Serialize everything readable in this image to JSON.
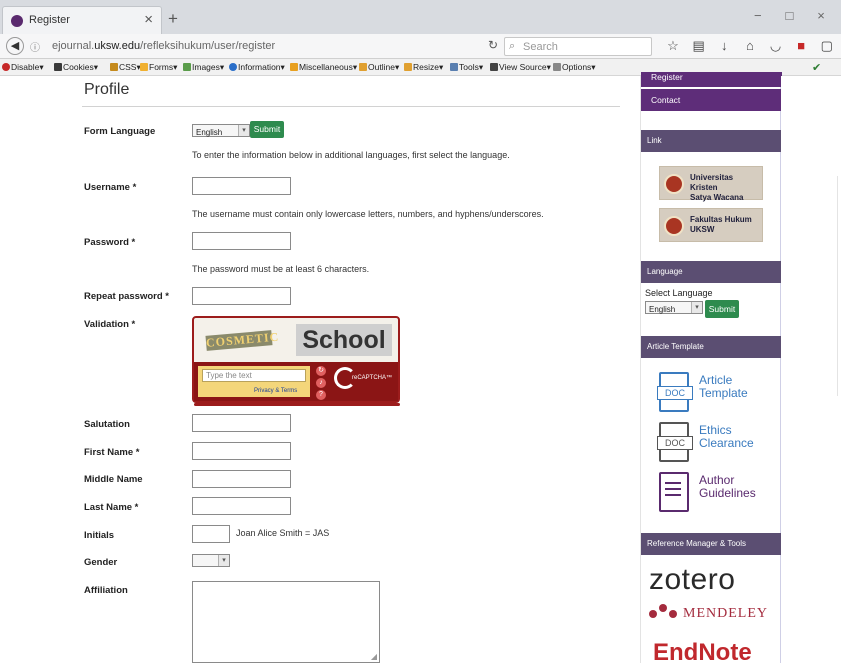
{
  "browser": {
    "tab_title": "Register",
    "tab_close": "×",
    "new_tab": "+",
    "window_controls": [
      "−",
      "□",
      "×"
    ],
    "url_prefix": "ejournal.",
    "url_domain": "uksw.edu",
    "url_path": "/refleksihukum/user/register",
    "search_placeholder": "Search",
    "nav_icons": [
      "star-icon",
      "reader-icon",
      "download-icon",
      "home-icon",
      "pocket-icon",
      "extension-icon",
      "sidebar-icon",
      "menu-icon"
    ]
  },
  "webdev_toolbar": {
    "items": [
      "Disable",
      "Cookies",
      "CSS",
      "Forms",
      "Images",
      "Information",
      "Miscellaneous",
      "Outline",
      "Resize",
      "Tools",
      "View Source",
      "Options"
    ]
  },
  "page": {
    "title": "Profile",
    "form_language": {
      "label": "Form Language",
      "value": "English",
      "submit": "Submit",
      "help": "To enter the information below in additional languages, first select the language."
    },
    "username": {
      "label": "Username *",
      "help": "The username must contain only lowercase letters, numbers, and hyphens/underscores."
    },
    "password": {
      "label": "Password *",
      "help": "The password must be at least 6 characters."
    },
    "repeat_password": {
      "label": "Repeat password *"
    },
    "validation": {
      "label": "Validation *",
      "word1": "COSMETIC",
      "word2": "School",
      "placeholder": "Type the text",
      "privacy": "Privacy & Terms",
      "brand": "reCAPTCHA™"
    },
    "salutation": {
      "label": "Salutation"
    },
    "first_name": {
      "label": "First Name *"
    },
    "middle_name": {
      "label": "Middle Name"
    },
    "last_name": {
      "label": "Last Name *"
    },
    "initials": {
      "label": "Initials",
      "hint": "Joan Alice Smith = JAS"
    },
    "gender": {
      "label": "Gender"
    },
    "affiliation": {
      "label": "Affiliation"
    }
  },
  "sidebar": {
    "register": "Register",
    "contact": "Contact",
    "link_heading": "Link",
    "links": [
      {
        "line1": "Universitas Kristen",
        "line2": "Satya Wacana"
      },
      {
        "line1": "Fakultas Hukum",
        "line2": "UKSW"
      }
    ],
    "language_heading": "Language",
    "select_language": "Select Language",
    "language_value": "English",
    "language_submit": "Submit",
    "article_heading": "Article Template",
    "templates": [
      {
        "doc": "DOC",
        "line1": "Article",
        "line2": "Template"
      },
      {
        "doc": "DOC",
        "line1": "Ethics",
        "line2": "Clearance"
      },
      {
        "doc": "",
        "line1": "Author",
        "line2": "Guidelines"
      }
    ],
    "reference_heading": "Reference Manager & Tools",
    "zotero": "zotero",
    "mendeley": "MENDELEY",
    "endnote": "EndNote"
  }
}
